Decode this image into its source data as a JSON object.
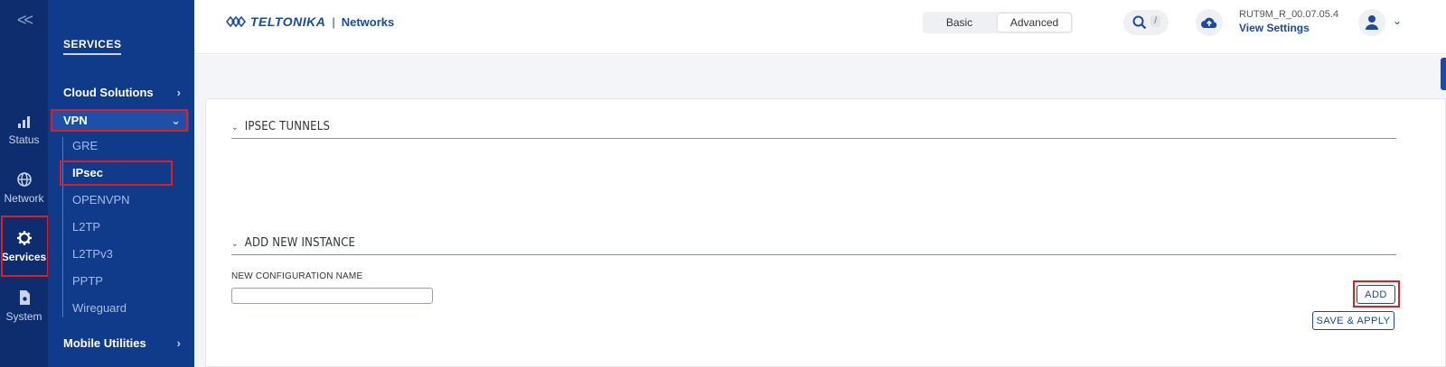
{
  "rail": {
    "collapse": "<<",
    "items": [
      {
        "label": "Status",
        "icon": "signal-icon"
      },
      {
        "label": "Network",
        "icon": "globe-icon"
      },
      {
        "label": "Services",
        "icon": "gear-icon"
      },
      {
        "label": "System",
        "icon": "system-icon"
      }
    ]
  },
  "sidebar": {
    "title": "SERVICES",
    "cloud": "Cloud Solutions",
    "vpn": "VPN",
    "sub": [
      "GRE",
      "IPsec",
      "OPENVPN",
      "L2TP",
      "L2TPv3",
      "PPTP",
      "Wireguard"
    ],
    "mobile": "Mobile Utilities"
  },
  "header": {
    "brand": "TELTONIKA",
    "networks": "Networks",
    "mode_basic": "Basic",
    "mode_advanced": "Advanced",
    "search_key": "/",
    "firmware": "RUT9M_R_00.07.05.4",
    "view_settings": "View Settings"
  },
  "main": {
    "tunnels_title": "IPSEC TUNNELS",
    "add_title": "ADD NEW INSTANCE",
    "field_label": "NEW CONFIGURATION NAME",
    "field_value": "",
    "add_btn": "ADD",
    "save_btn": "SAVE & APPLY"
  },
  "colors": {
    "rail_bg": "#0e2d6e",
    "sidebar_bg": "#103a8a",
    "accent": "#1b4aa0",
    "highlight": "#e31b23"
  }
}
